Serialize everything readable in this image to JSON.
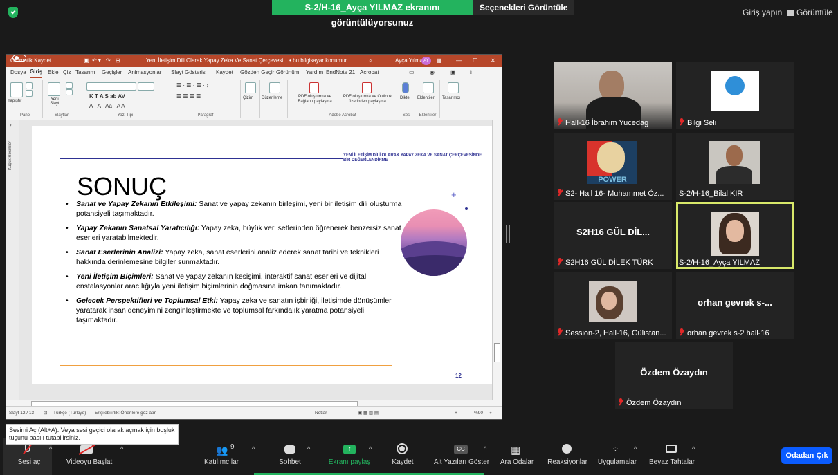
{
  "topbar": {
    "share_banner": "S-2/H-16_Ayça YILMAZ ekranını görüntülüyorsunuz",
    "view_options": "Seçenekleri Görüntüle",
    "signin": "Giriş yapın",
    "view": "Görüntüle"
  },
  "ppt": {
    "autosave": "Otomatik Kaydet",
    "doc_title": "Yeni İletişim Dili Olarak Yapay Zeka Ve Sanat Çerçevesi... • bu bilgisayar konumuna kaydedildi",
    "user": "Ayça Yılmaz",
    "user_initials": "AY",
    "menu": [
      "Dosya",
      "Giriş",
      "Ekle",
      "Çiz",
      "Tasarım",
      "Geçişler",
      "Animasyonlar",
      "Slayt Gösterisi",
      "Kaydet",
      "Gözden Geçir",
      "Görünüm",
      "Yardım",
      "EndNote 21",
      "Acrobat"
    ],
    "ribbon": {
      "paste": "Yapıştır",
      "new_slide": "Yeni Slayt",
      "group_pano": "Pano",
      "group_slides": "Slaytlar",
      "group_font": "Yazı Tipi",
      "group_paragraph": "Paragraf",
      "drawing": "Çizim",
      "editing": "Düzenleme",
      "pdf_share": "PDF oluşturma ve Bağlantı paylaşma",
      "pdf_outlook": "PDF oluşturma ve Outlook üzerinden paylaşma",
      "group_acrobat": "Adobe Acrobat",
      "dictate": "Dikte",
      "group_voice": "Ses",
      "addins": "Eklentiler",
      "group_addins": "Eklentiler",
      "designer": "Tasarımcı"
    },
    "side_label": "Küçük Resimler",
    "status": {
      "slide": "Slayt 12 / 13",
      "language": "Türkçe (Türkiye)",
      "accessibility": "Erişilebilirlik: Önerilere göz atın",
      "notes": "Notlar",
      "zoom": "%90"
    },
    "slide": {
      "header": "YENİ İLETİŞİM DİLİ OLARAK YAPAY ZEKA VE SANAT ÇERÇEVESİNDE BİR DEĞERLENDİRME",
      "title": "SONUÇ",
      "bullets": [
        {
          "bold": "Sanat ve Yapay Zekanın Etkileşimi:",
          "text": " Sanat ve yapay zekanın birleşimi, yeni bir iletişim dili oluşturma potansiyeli taşımaktadır."
        },
        {
          "bold": "Yapay Zekanın Sanatsal Yaratıcılığı:",
          "text": " Yapay zeka, büyük veri setlerinden öğrenerek benzersiz sanat eserleri yaratabilmektedir."
        },
        {
          "bold": "Sanat Eserlerinin Analizi:",
          "text": " Yapay zeka, sanat eserlerini analiz ederek sanat tarihi ve teknikleri hakkında derinlemesine bilgiler sunmaktadır."
        },
        {
          "bold": "Yeni İletişim Biçimleri:",
          "text": " Sanat ve yapay zekanın kesişimi, interaktif sanat eserleri ve dijital enstalasyonlar aracılığıyla yeni iletişim biçimlerinin doğmasına imkan tanımaktadır."
        },
        {
          "bold": "Gelecek Perspektifleri ve Toplumsal Etki:",
          "text": " Yapay zeka ve sanatın işbirliği, iletişimde dönüşümler yaratarak insan deneyimini zenginleştirmekte ve toplumsal farkındalık yaratma potansiyeli taşımaktadır."
        }
      ],
      "page": "12"
    }
  },
  "participants": [
    {
      "name": "Hall-16 İbrahim Yucedag",
      "big": ""
    },
    {
      "name": "Bilgi Seli",
      "big": ""
    },
    {
      "name": "S2- Hall 16- Muhammet Öz...",
      "big": "",
      "poster": "POWER"
    },
    {
      "name": "S-2/H-16_Bilal KIR",
      "big": ""
    },
    {
      "name": "S2H16  GÜL DİLEK TÜRK",
      "big": "S2H16  GÜL DİL..."
    },
    {
      "name": "S-2/H-16_Ayça YILMAZ",
      "big": ""
    },
    {
      "name": "Session-2, Hall-16, Gülistan...",
      "big": ""
    },
    {
      "name": "orhan gevrek s-2 hall-16",
      "big": "orhan gevrek s-..."
    },
    {
      "name": "Özdem Özaydın",
      "big": "Özdem Özaydın"
    }
  ],
  "toast": "Sesimi Aç (Alt+A). Veya sesi geçici olarak açmak için boşluk tuşunu basılı tutabilirsiniz.",
  "toolbar": {
    "unmute": "Sesi aç",
    "video": "Videoyu Başlat",
    "participants": "Katılımcılar",
    "participants_count": "9",
    "chat": "Sohbet",
    "share": "Ekranı paylaş",
    "record": "Kaydet",
    "captions": "Alt Yazıları Göster",
    "breakout": "Ara Odalar",
    "reactions": "Reaksiyonlar",
    "apps": "Uygulamalar",
    "whiteboards": "Beyaz Tahtalar",
    "leave": "Odadan Çık"
  },
  "colors": {
    "accent_green": "#23b35e",
    "ppt_red": "#b7472a",
    "leave_blue": "#0b5cff",
    "active_outline": "#d8e86a"
  }
}
